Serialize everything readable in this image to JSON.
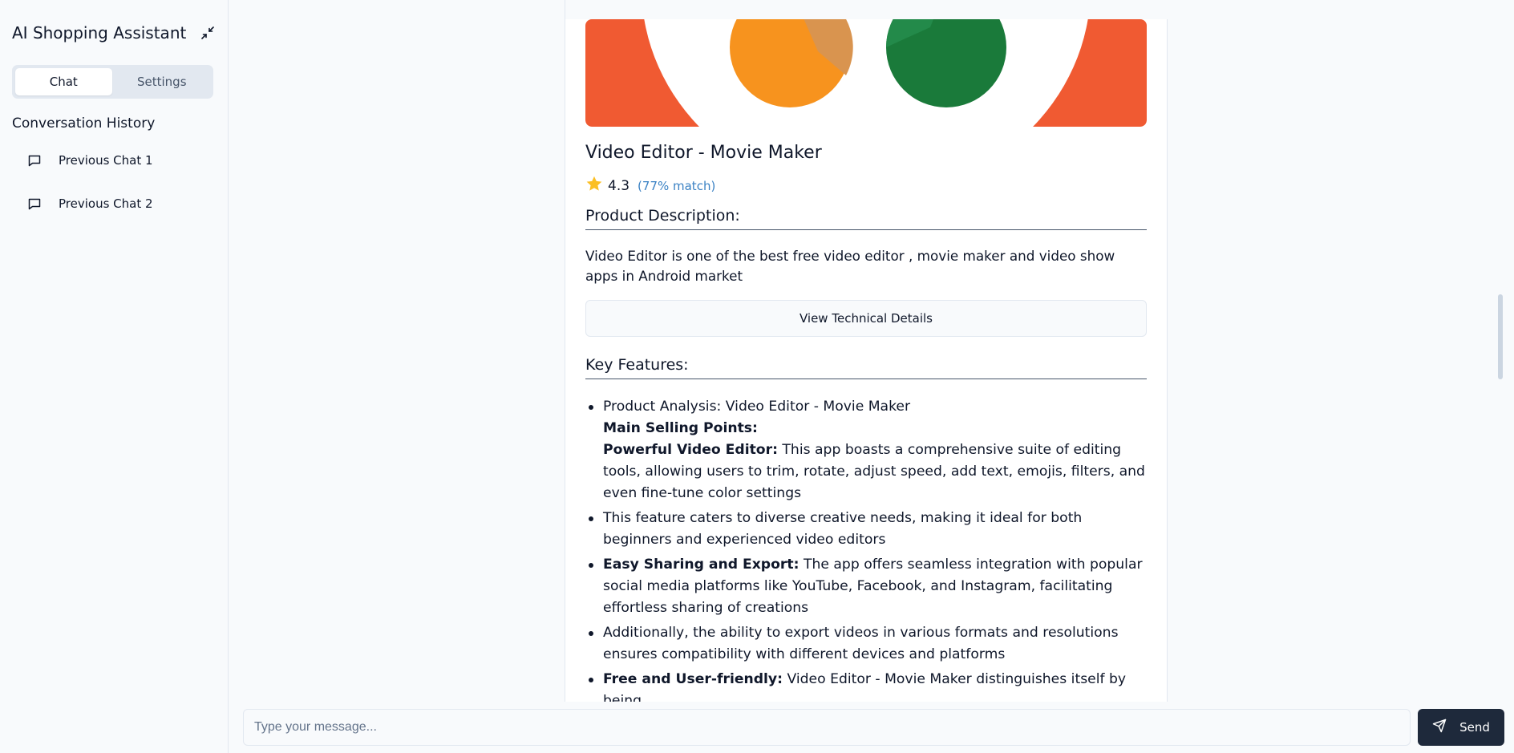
{
  "sidebar": {
    "title": "AI Shopping Assistant",
    "collapse_icon": "collapse-arrows-icon",
    "tabs": [
      {
        "label": "Chat",
        "active": true
      },
      {
        "label": "Settings",
        "active": false
      }
    ],
    "history_title": "Conversation History",
    "history": [
      {
        "label": "Previous Chat 1",
        "icon": "message-square-icon"
      },
      {
        "label": "Previous Chat 2",
        "icon": "message-square-icon"
      }
    ]
  },
  "product": {
    "name": "Video Editor - Movie Maker",
    "rating": "4.3",
    "match": "(77% match)",
    "description_heading": "Product Description:",
    "description": "Video Editor is one of the best free video editor , movie maker and video show apps in Android market",
    "tech_button": "View Technical Details",
    "features_heading": "Key Features:",
    "features": [
      {
        "line1": "Product Analysis: Video Editor - Movie Maker",
        "bold_heading": "Main Selling Points:",
        "bold_lead": "Powerful Video Editor:",
        "text": " This app boasts a comprehensive suite of editing tools, allowing users to trim, rotate, adjust speed, add text, emojis, filters, and even fine-tune color settings"
      },
      {
        "text": "This feature caters to diverse creative needs, making it ideal for both beginners and experienced video editors"
      },
      {
        "bold_lead": "Easy Sharing and Export:",
        "text": " The app offers seamless integration with popular social media platforms like YouTube, Facebook, and Instagram, facilitating effortless sharing of creations"
      },
      {
        "text": "Additionally, the ability to export videos in various formats and resolutions ensures compatibility with different devices and platforms"
      },
      {
        "bold_lead": "Free and User-friendly:",
        "text": " Video Editor - Movie Maker distinguishes itself by being"
      }
    ]
  },
  "composer": {
    "placeholder": "Type your message...",
    "send_label": "Send",
    "send_icon": "send-icon"
  },
  "colors": {
    "logo_orange_red": "#f05a32",
    "logo_orange": "#f7931e",
    "logo_green": "#1a7a3a",
    "star": "#fbbf24",
    "match_link": "#3b82c4",
    "send_bg": "#1e293b"
  }
}
